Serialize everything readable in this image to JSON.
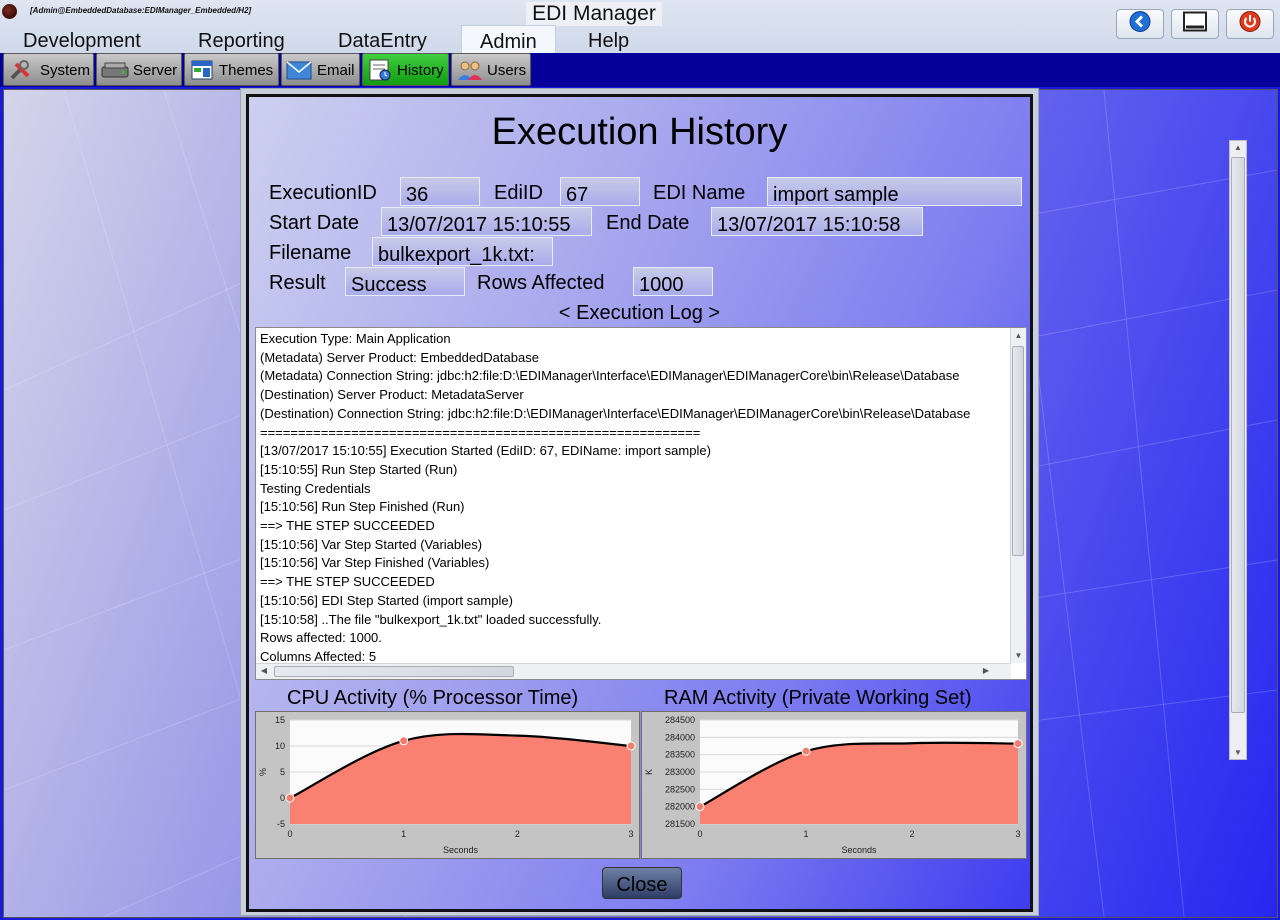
{
  "window": {
    "connection_label": "[Admin@EmbeddedDatabase:EDIManager_Embedded/H2]",
    "app_title": "EDI Manager"
  },
  "menu": {
    "items": [
      "Development",
      "Reporting",
      "DataEntry",
      "Admin",
      "Help"
    ],
    "active": "Admin"
  },
  "tabs": {
    "items": [
      {
        "label": "System",
        "icon": "wrench-icon"
      },
      {
        "label": "Server",
        "icon": "server-icon"
      },
      {
        "label": "Themes",
        "icon": "themes-icon"
      },
      {
        "label": "Email",
        "icon": "envelope-icon"
      },
      {
        "label": "History",
        "icon": "history-icon"
      },
      {
        "label": "Users",
        "icon": "users-icon"
      }
    ],
    "active": "History"
  },
  "dialog": {
    "title": "Execution History",
    "labels": {
      "execution_id": "ExecutionID",
      "edi_id": "EdiID",
      "edi_name": "EDI Name",
      "start_date": "Start Date",
      "end_date": "End Date",
      "filename": "Filename",
      "result": "Result",
      "rows_affected": "Rows Affected"
    },
    "values": {
      "execution_id": "36",
      "edi_id": "67",
      "edi_name": "import sample",
      "start_date": "13/07/2017 15:10:55",
      "end_date": "13/07/2017 15:10:58",
      "filename": "bulkexport_1k.txt:",
      "result": "Success",
      "rows_affected": "1000"
    },
    "log_header": "< Execution Log >",
    "log_lines": [
      "Execution Type: Main Application",
      "(Metadata) Server Product: EmbeddedDatabase",
      "(Metadata) Connection String: jdbc:h2:file:D:\\EDIManager\\Interface\\EDIManager\\EDIManagerCore\\bin\\Release\\Database",
      "(Destination) Server Product: MetadataServer",
      "(Destination) Connection String: jdbc:h2:file:D:\\EDIManager\\Interface\\EDIManager\\EDIManagerCore\\bin\\Release\\Database",
      "==========================================================",
      "[13/07/2017 15:10:55] Execution Started (EdiID: 67, EDIName: import sample)",
      "[15:10:55] Run Step Started (Run)",
      "Testing Credentials",
      "[15:10:56] Run Step Finished (Run)",
      "==> THE STEP SUCCEEDED",
      "[15:10:56] Var Step Started (Variables)",
      "[15:10:56] Var Step Finished (Variables)",
      "==> THE STEP SUCCEEDED",
      "[15:10:56] EDI Step Started (import sample)",
      "[15:10:58] ..The file \"bulkexport_1k.txt\" loaded successfully.",
      "Rows affected: 1000.",
      "Columns Affected: 5"
    ],
    "close_label": "Close"
  },
  "colors": {
    "tab_strip": "#05009a",
    "active_tab": "#22b022",
    "chart_fill": "#fa8072",
    "chart_line": "#000000"
  },
  "chart_data": [
    {
      "type": "area",
      "title": "CPU Activity (% Processor Time)",
      "xlabel": "Seconds",
      "ylabel": "%",
      "x": [
        0,
        1,
        2,
        3
      ],
      "xticks": [
        "0",
        "1",
        "2",
        "3"
      ],
      "yticks": [
        "15",
        "10",
        "5",
        "0",
        "-5"
      ],
      "ylim": [
        -5,
        15
      ],
      "series": [
        {
          "values": [
            0,
            11,
            12,
            10
          ]
        }
      ],
      "markers_at": [
        0,
        1,
        3
      ],
      "grid": true
    },
    {
      "type": "area",
      "title": "RAM Activity (Private Working Set)",
      "xlabel": "Seconds",
      "ylabel": "K",
      "x": [
        0,
        1,
        2,
        3
      ],
      "xticks": [
        "0",
        "1",
        "2",
        "3"
      ],
      "yticks": [
        "284500",
        "284000",
        "283500",
        "283000",
        "282500",
        "282000",
        "281500"
      ],
      "ylim": [
        281500,
        284500
      ],
      "series": [
        {
          "values": [
            282000,
            283600,
            283830,
            283820
          ]
        }
      ],
      "markers_at": [
        0,
        1,
        3
      ],
      "grid": true
    }
  ]
}
